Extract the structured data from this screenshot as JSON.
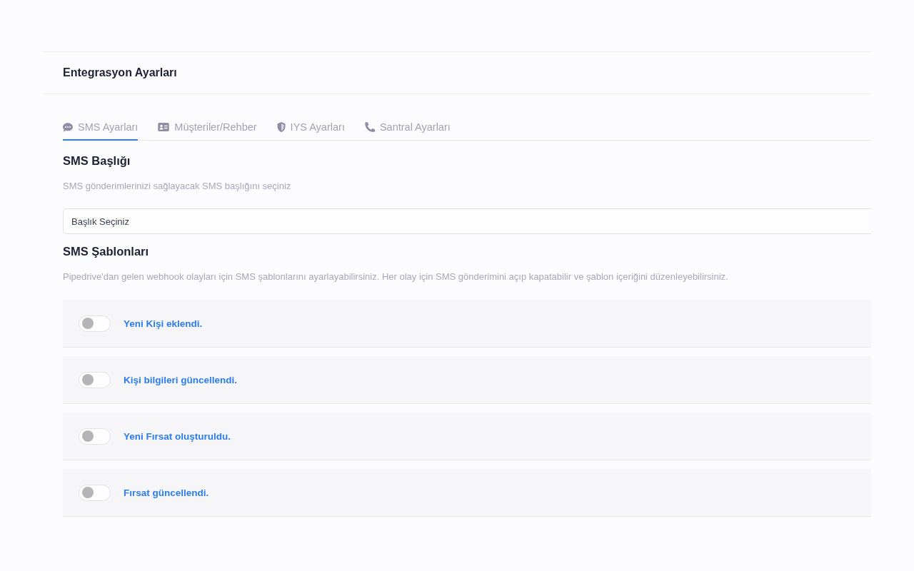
{
  "header": {
    "title": "Entegrasyon Ayarları"
  },
  "tabs": [
    {
      "label": "SMS Ayarları",
      "selected": true
    },
    {
      "label": "Müşteriler/Rehber",
      "selected": false
    },
    {
      "label": "IYS Ayarları",
      "selected": false
    },
    {
      "label": "Santral Ayarları",
      "selected": false
    }
  ],
  "sms_header": {
    "title": "SMS Başlığı",
    "description": "SMS gönderimlerinizi sağlayacak SMS başlığını seçiniz",
    "select": {
      "value": "Başlık Seçiniz"
    }
  },
  "sms_templates": {
    "title": "SMS Şablonları",
    "description": "Pipedrive'dan gelen webhook olayları için SMS şablonlarını ayarlayabilirsiniz. Her olay için SMS gönderimini açıp kapatabilir ve şablon içeriğini düzenleyebilirsiniz.",
    "items": [
      {
        "label": "Yeni Kişi eklendi.",
        "on": false
      },
      {
        "label": "Kişi bilgileri güncellendi.",
        "on": false
      },
      {
        "label": "Yeni Fırsat oluşturuldu.",
        "on": false
      },
      {
        "label": "Fırsat güncellendi.",
        "on": false
      }
    ]
  }
}
